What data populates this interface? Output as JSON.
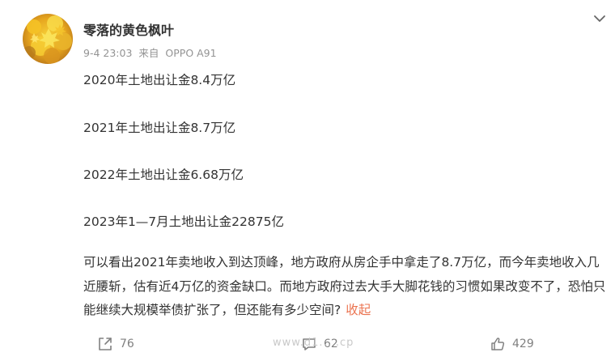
{
  "author": {
    "name": "零落的黄色枫叶",
    "avatar_icon": "autumn-maple-leaves-avatar"
  },
  "meta": {
    "time": "9-4 23:03",
    "source_prefix": "来自",
    "device": "OPPO A91"
  },
  "post": {
    "lines": [
      "2020年土地出让金8.4万亿",
      "2021年土地出让金8.7万亿",
      "2022年土地出让金6.68万亿",
      "2023年1—7月土地出让金22875亿"
    ],
    "paragraph": "可以看出2021年卖地收入到达顶峰，地方政府从房企手中拿走了8.7万亿，而今年卖地收入几近腰斩，估有近4万亿的资金缺口。而地方政府过去大手大脚花钱的习惯如果改变不了，恐怕只能继续大规模举债扩张了，但还能有多少空间?",
    "collapse_label": "收起"
  },
  "actions": {
    "repost_count": "76",
    "comment_count": "62",
    "like_count": "429"
  },
  "watermark": "www.d1... .cp",
  "colors": {
    "text": "#333333",
    "meta": "#939393",
    "link": "#eb7350",
    "action": "#808080"
  }
}
